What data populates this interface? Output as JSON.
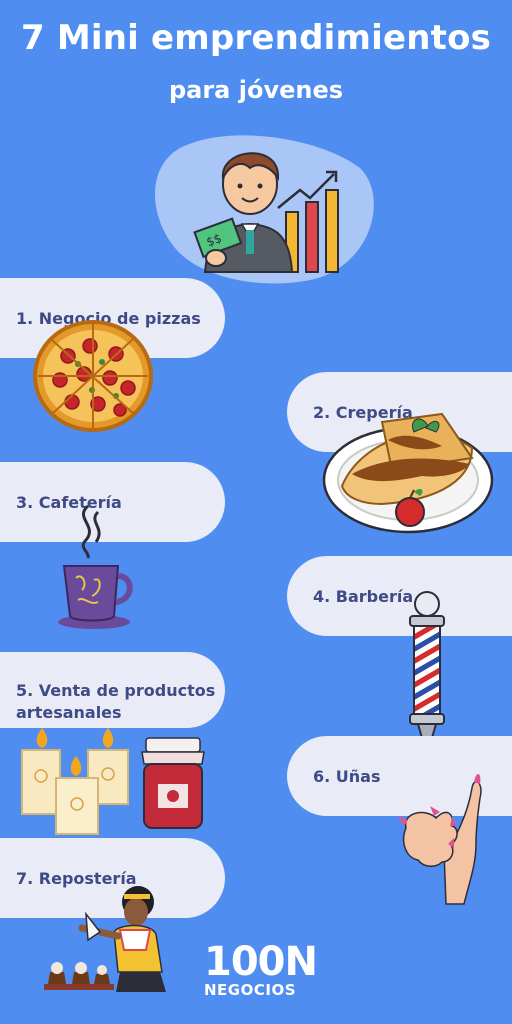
{
  "header": {
    "title": "7 Mini emprendimientos",
    "subtitle": "para jóvenes"
  },
  "items": [
    {
      "label": "1. Negocio de pizzas",
      "icon": "pizza-icon"
    },
    {
      "label": "2. Crepería",
      "icon": "crepe-plate-icon"
    },
    {
      "label": "3. Cafetería",
      "icon": "coffee-cup-icon"
    },
    {
      "label": "4. Barbería",
      "icon": "barber-pole-icon"
    },
    {
      "label": "5. Venta de productos artesanales",
      "label_line1": "5. Venta de productos",
      "label_line2": "artesanales",
      "icon": "candles-jar-icon"
    },
    {
      "label": "6. Uñas",
      "icon": "manicure-hand-icon"
    },
    {
      "label": "7. Repostería",
      "icon": "baker-icon"
    }
  ],
  "brand": {
    "number": "100N",
    "name": "NEGOCIOS"
  },
  "colors": {
    "background": "#4f8ef0",
    "pill": "#e9ecf6",
    "label_text": "#3f4a86"
  }
}
